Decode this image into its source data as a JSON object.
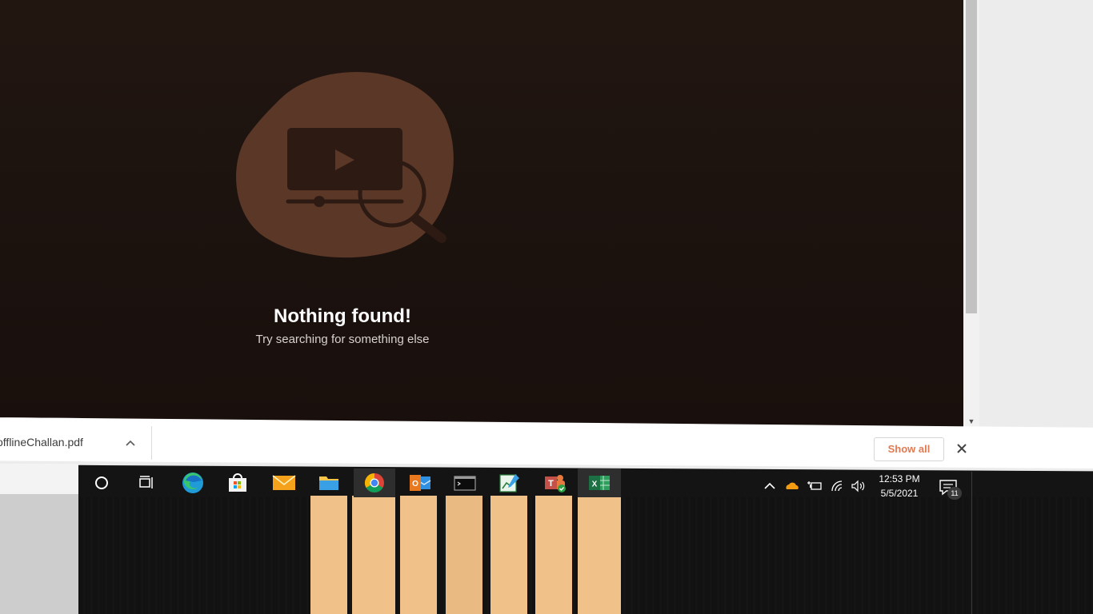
{
  "empty_state": {
    "title": "Nothing found!",
    "subtitle": "Try searching for something else"
  },
  "downloads": {
    "file_name": "offlineChallan.pdf",
    "show_all_label": "Show all"
  },
  "taskbar": {
    "apps": [
      {
        "name": "cortana-icon"
      },
      {
        "name": "task-view-icon"
      },
      {
        "name": "edge-icon"
      },
      {
        "name": "store-icon"
      },
      {
        "name": "mail-icon"
      },
      {
        "name": "file-explorer-icon"
      },
      {
        "name": "chrome-icon"
      },
      {
        "name": "outlook-icon"
      },
      {
        "name": "terminal-icon"
      },
      {
        "name": "chart-app-icon"
      },
      {
        "name": "teams-icon"
      },
      {
        "name": "excel-icon"
      }
    ],
    "clock": {
      "time": "12:53 PM",
      "date": "5/5/2021"
    },
    "notifications_count": "11"
  },
  "colors": {
    "page_bg": "#1c130f",
    "blob": "#5a3726",
    "accent_orange": "#e07b53",
    "ghost_orange": "#f0c28a"
  }
}
